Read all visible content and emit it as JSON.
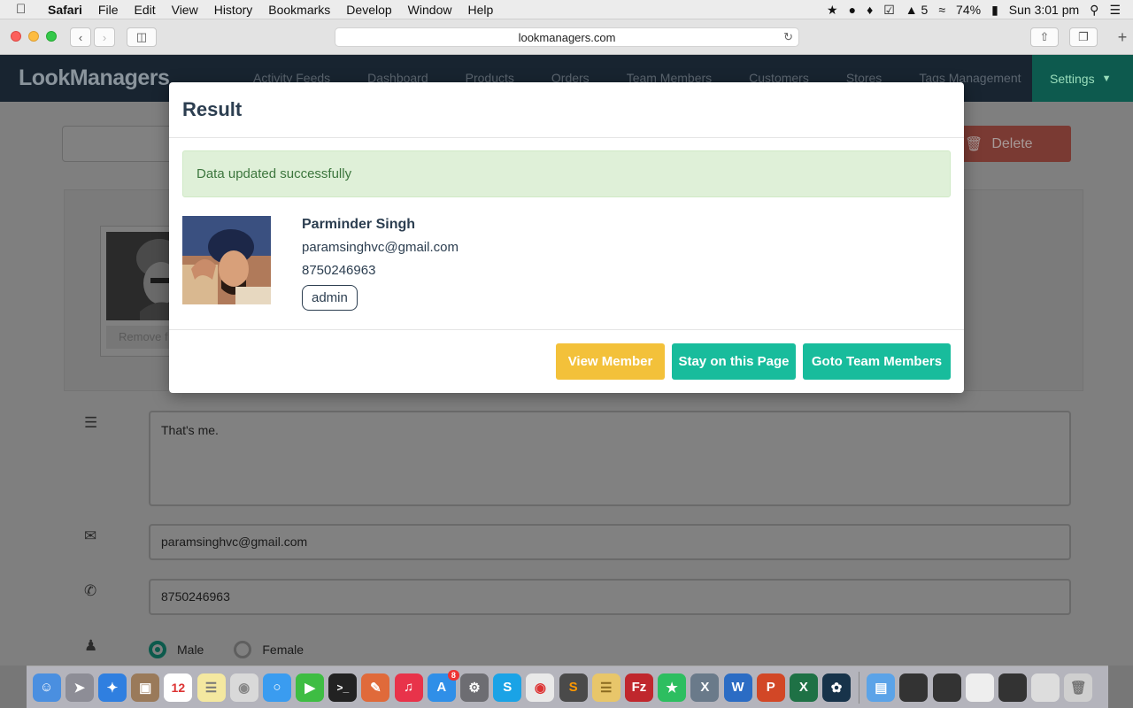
{
  "menubar": {
    "apple": "",
    "app": "Safari",
    "items": [
      "File",
      "Edit",
      "View",
      "History",
      "Bookmarks",
      "Develop",
      "Window",
      "Help"
    ],
    "status": {
      "adobe_count": "5",
      "battery": "74%",
      "clock": "Sun 3:01 pm"
    }
  },
  "safari": {
    "url": "lookmanagers.com"
  },
  "app": {
    "brand": "LookManagers",
    "nav": [
      "Activity Feeds",
      "Dashboard",
      "Products",
      "Orders",
      "Team Members",
      "Customers",
      "Stores",
      "Tags Management"
    ],
    "settings": "Settings",
    "delete_label": "Delete",
    "photo_remove": "Remove f",
    "bio": "That's me.",
    "email": "paramsinghvc@gmail.com",
    "phone": "8750246963",
    "gender": {
      "male": "Male",
      "female": "Female",
      "selected": "Male"
    }
  },
  "modal": {
    "title": "Result",
    "alert": "Data updated successfully",
    "member": {
      "name": "Parminder Singh",
      "email": "paramsinghvc@gmail.com",
      "phone": "8750246963",
      "role": "admin"
    },
    "buttons": {
      "view": "View Member",
      "stay": "Stay on this Page",
      "goto": "Goto Team Members"
    }
  },
  "colors": {
    "navbar": "#2c3e50",
    "success": "#18bc9c",
    "warning": "#f3c13a",
    "danger": "#e74c3c",
    "alert_bg": "#dff0d8",
    "alert_text": "#3c763d"
  },
  "dock": {
    "calendar_day": "12",
    "appstore_badge": "8"
  }
}
